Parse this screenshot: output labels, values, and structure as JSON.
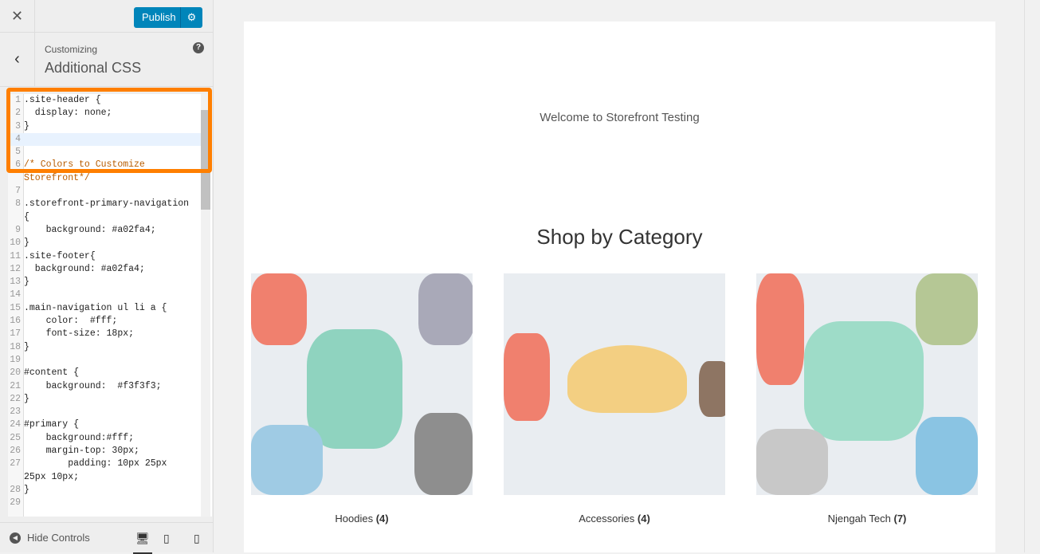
{
  "topbar": {
    "close_icon": "close-icon",
    "publish_label": "Publish",
    "settings_icon": "gear-icon"
  },
  "header": {
    "subtitle": "Customizing",
    "title": "Additional CSS",
    "help": "?"
  },
  "editor": {
    "lines": [
      {
        "n": "1",
        "t": ".site-header {"
      },
      {
        "n": "2",
        "t": "  display: none;"
      },
      {
        "n": "3",
        "t": "}"
      },
      {
        "n": "4",
        "t": ""
      },
      {
        "n": "5",
        "t": ""
      },
      {
        "n": "6",
        "t": "/* Colors to Customize"
      },
      {
        "n": "",
        "t": "Storefront*/"
      },
      {
        "n": "7",
        "t": ""
      },
      {
        "n": "8",
        "t": ".storefront-primary-navigation"
      },
      {
        "n": "",
        "t": "{"
      },
      {
        "n": "9",
        "t": "    background: #a02fa4;"
      },
      {
        "n": "10",
        "t": "}"
      },
      {
        "n": "11",
        "t": ".site-footer{"
      },
      {
        "n": "12",
        "t": "  background: #a02fa4;"
      },
      {
        "n": "13",
        "t": "}"
      },
      {
        "n": "14",
        "t": ""
      },
      {
        "n": "15",
        "t": ".main-navigation ul li a {"
      },
      {
        "n": "16",
        "t": "    color:  #fff;"
      },
      {
        "n": "17",
        "t": "    font-size: 18px;"
      },
      {
        "n": "18",
        "t": "}"
      },
      {
        "n": "19",
        "t": ""
      },
      {
        "n": "20",
        "t": "#content {"
      },
      {
        "n": "21",
        "t": "    background:  #f3f3f3;"
      },
      {
        "n": "22",
        "t": "}"
      },
      {
        "n": "23",
        "t": ""
      },
      {
        "n": "24",
        "t": "#primary {"
      },
      {
        "n": "25",
        "t": "    background:#fff;"
      },
      {
        "n": "26",
        "t": "    margin-top: 30px;"
      },
      {
        "n": "27",
        "t": "        padding: 10px 25px"
      },
      {
        "n": "",
        "t": "25px 10px;"
      },
      {
        "n": "28",
        "t": "}"
      },
      {
        "n": "29",
        "t": ""
      }
    ]
  },
  "footer": {
    "hide_label": "Hide Controls"
  },
  "preview": {
    "welcome": "Welcome to Storefront Testing",
    "heading": "Shop by Category",
    "categories": [
      {
        "name": "Hoodies",
        "count": "(4)"
      },
      {
        "name": "Accessories",
        "count": "(4)"
      },
      {
        "name": "Njengah Tech",
        "count": "(7)"
      }
    ]
  },
  "colors": {
    "highlight": "#ff7f00",
    "publish": "#0085ba"
  }
}
